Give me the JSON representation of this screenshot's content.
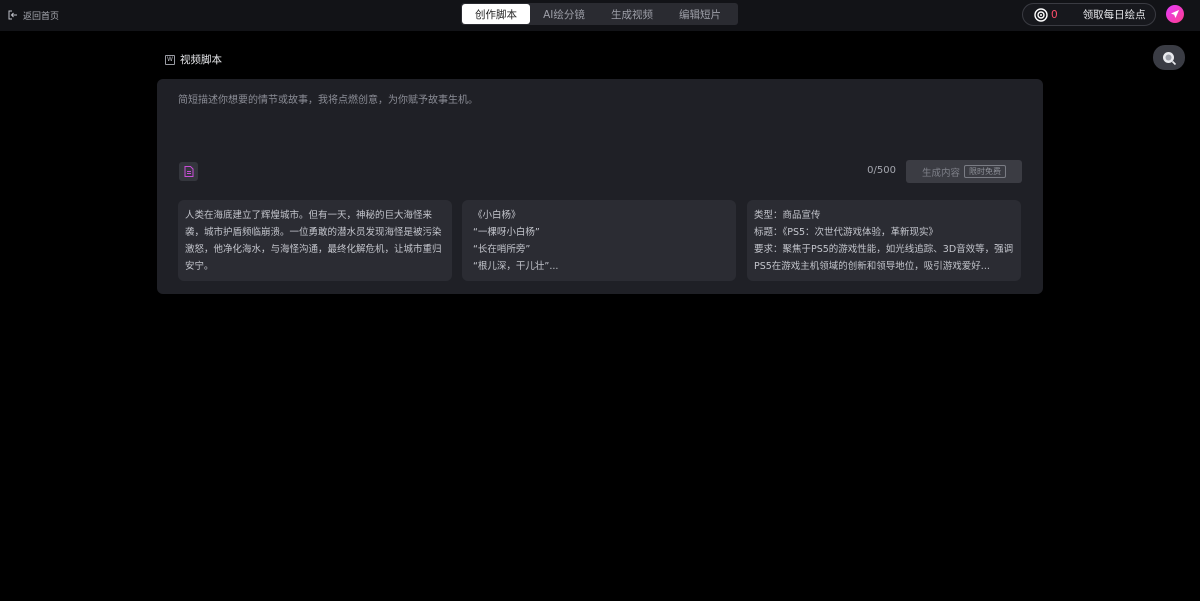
{
  "header": {
    "back_label": "返回首页",
    "tabs": [
      {
        "label": "创作脚本",
        "active": true
      },
      {
        "label": "AI绘分镜",
        "active": false
      },
      {
        "label": "生成视频",
        "active": false
      },
      {
        "label": "编辑短片",
        "active": false
      }
    ],
    "points": {
      "count": "0",
      "label": "领取每日绘点"
    }
  },
  "section": {
    "title": "视频脚本",
    "icon_letter": "W"
  },
  "editor": {
    "placeholder": "简短描述你想要的情节或故事，我将点燃创意，为你赋予故事生机。",
    "counter": "0/500",
    "generate_label": "生成内容",
    "free_badge": "限时免费"
  },
  "samples": [
    {
      "text": "人类在海底建立了辉煌城市。但有一天，神秘的巨大海怪来袭，城市护盾频临崩溃。一位勇敢的潜水员发现海怪是被污染激怒，他净化海水，与海怪沟通，最终化解危机，让城市重归安宁。"
    },
    {
      "lines": [
        "《小白杨》",
        "“一棵呀小白杨”",
        "“长在哨所旁”",
        "“根儿深，干儿壮”..."
      ]
    },
    {
      "lines": [
        "类型：商品宣传",
        "标题：《PS5：次世代游戏体验，革新现实》"
      ],
      "text": "要求：聚焦于PS5的游戏性能，如光线追踪、3D音效等，强调PS5在游戏主机领域的创新和领导地位，吸引游戏爱好..."
    }
  ],
  "colors": {
    "accent": "#ff3d8b",
    "points_count": "#ff4d6a",
    "card_bg": "#1f2026"
  }
}
